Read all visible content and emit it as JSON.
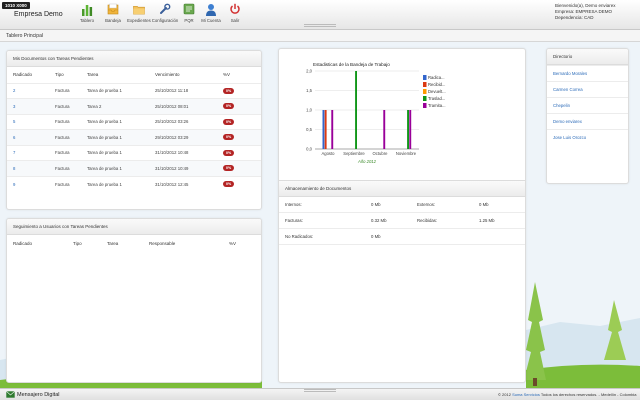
{
  "app": {
    "badge": "1010 X000",
    "name": "Empresa Demo"
  },
  "nav": [
    {
      "label": "Tablero",
      "icon": "bar-chart-icon"
    },
    {
      "label": "Bandeja",
      "icon": "tray-icon"
    },
    {
      "label": "Expedientes",
      "icon": "folder-icon"
    },
    {
      "label": "Configuración",
      "icon": "wrench-icon"
    },
    {
      "label": "PQR",
      "icon": "pqr-icon"
    },
    {
      "label": "Mi Cuenta",
      "icon": "user-icon"
    },
    {
      "label": "Salir",
      "icon": "power-icon"
    }
  ],
  "user": {
    "greeting": "Bienvenido(a), Demo enviarex",
    "company": "Empresa: EMPRESA DEMO",
    "dependency": "Dependencia: CAD"
  },
  "page_title": "Tablero Principal",
  "docs": {
    "title": "Mis Documentos con Tareas Pendientes",
    "columns": [
      "Radicado",
      "Tipo",
      "Tarea",
      "Vencimiento",
      "%V"
    ],
    "rows": [
      {
        "radicado": "2",
        "tipo": "Factura",
        "tarea": "Tarea de prueba 1",
        "vencimiento": "25/10/2012 11:18",
        "pct": "0%"
      },
      {
        "radicado": "3",
        "tipo": "Factura",
        "tarea": "Tarea 2",
        "vencimiento": "25/10/2012 08:01",
        "pct": "0%"
      },
      {
        "radicado": "5",
        "tipo": "Factura",
        "tarea": "Tarea de prueba 1",
        "vencimiento": "25/10/2012 03:26",
        "pct": "0%"
      },
      {
        "radicado": "6",
        "tipo": "Factura",
        "tarea": "Tarea de prueba 1",
        "vencimiento": "29/10/2012 03:29",
        "pct": "0%"
      },
      {
        "radicado": "7",
        "tipo": "Factura",
        "tarea": "Tarea de prueba 1",
        "vencimiento": "31/10/2012 10:48",
        "pct": "0%"
      },
      {
        "radicado": "8",
        "tipo": "Factura",
        "tarea": "Tarea de prueba 1",
        "vencimiento": "31/10/2012 10:49",
        "pct": "0%"
      },
      {
        "radicado": "9",
        "tipo": "Factura",
        "tarea": "Tarea de prueba 1",
        "vencimiento": "31/10/2012 12:45",
        "pct": "0%"
      }
    ]
  },
  "seguimiento": {
    "title": "Seguimiento a Usuarios con Tareas Pendientes",
    "columns": [
      "Radicado",
      "Tipo",
      "Tarea",
      "Responsable",
      "%V"
    ]
  },
  "chart_data": {
    "type": "bar",
    "title": "Estadisticas de la Bandeja de Trabajo",
    "xlabel": "Año 2012",
    "ylabel": "",
    "categories": [
      "Agosto",
      "Septiembre",
      "Octubre",
      "Noviembre"
    ],
    "series": [
      {
        "name": "Radica...",
        "color": "#3366cc",
        "values": [
          1,
          0,
          0,
          0
        ]
      },
      {
        "name": "Recibid...",
        "color": "#dc3912",
        "values": [
          1,
          0,
          0,
          0
        ]
      },
      {
        "name": "Devuelt...",
        "color": "#ff9900",
        "values": [
          0,
          0,
          0,
          0
        ]
      },
      {
        "name": "Traslad...",
        "color": "#109618",
        "values": [
          0,
          2,
          0,
          1
        ]
      },
      {
        "name": "Tramita...",
        "color": "#990099",
        "values": [
          1,
          0,
          1,
          1
        ]
      }
    ],
    "y_ticks": [
      "0,0",
      "0,5",
      "1,0",
      "1,5",
      "2,0"
    ],
    "ylim": [
      0,
      2
    ],
    "legend": "right"
  },
  "storage": {
    "title": "Almacenamiento de Documentos",
    "rows": [
      {
        "l1": "Internos:",
        "v1": "0 Mb",
        "l2": "Externos:",
        "v2": "0 Mb"
      },
      {
        "l1": "Facturas:",
        "v1": "0.32 Mb",
        "l2": "Recibidas:",
        "v2": "1.25 Mb"
      },
      {
        "l1": "No Radicados:",
        "v1": "0 Mb",
        "l2": "",
        "v2": ""
      }
    ]
  },
  "directory": {
    "title": "Directorio",
    "items": [
      "Bernardo Morales",
      "Carmen Correa",
      "Chepelin",
      "Demo enviarex",
      "Jose Luis Orozco"
    ]
  },
  "footer": {
    "brand": "Mensajero Digital",
    "copy_prefix": "© 2012 ",
    "copy_link": "Suma Servicios",
    "copy_suffix": " Todos los derechos reservados. - Medellín - Colombia"
  },
  "colors": {
    "badge": "#b32424",
    "link": "#2a6ab8"
  }
}
